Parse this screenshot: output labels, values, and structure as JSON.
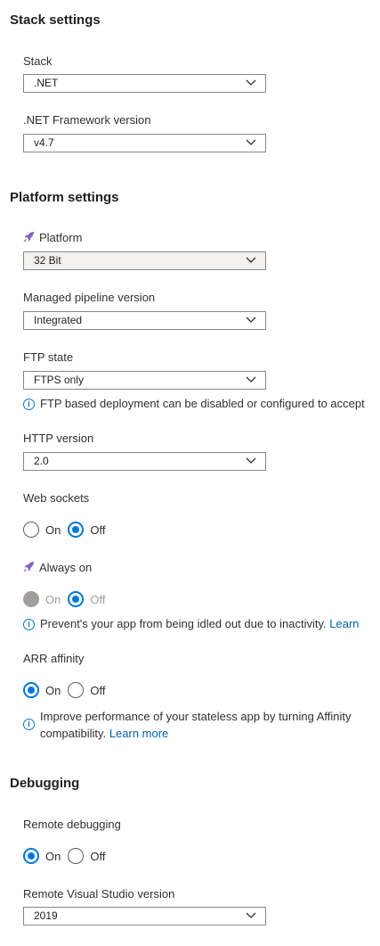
{
  "stack_settings": {
    "title": "Stack settings",
    "stack": {
      "label": "Stack",
      "value": ".NET"
    },
    "framework": {
      "label": ".NET Framework version",
      "value": "v4.7"
    }
  },
  "platform_settings": {
    "title": "Platform settings",
    "platform": {
      "label": "Platform",
      "value": "32 Bit"
    },
    "pipeline": {
      "label": "Managed pipeline version",
      "value": "Integrated"
    },
    "ftp": {
      "label": "FTP state",
      "value": "FTPS only",
      "info": "FTP based deployment can be disabled or configured to accept"
    },
    "http": {
      "label": "HTTP version",
      "value": "2.0"
    },
    "web_sockets": {
      "label": "Web sockets",
      "on": "On",
      "off": "Off",
      "selected": "Off"
    },
    "always_on": {
      "label": "Always on",
      "on": "On",
      "off": "Off",
      "selected": "Off",
      "info": "Prevent's your app from being idled out due to inactivity.",
      "info_link": "Learn"
    },
    "arr_affinity": {
      "label": "ARR affinity",
      "on": "On",
      "off": "Off",
      "selected": "On",
      "info_line1": "Improve performance of your stateless app by turning Affinity",
      "info_line2": "compatibility.",
      "info_link": "Learn more"
    }
  },
  "debugging": {
    "title": "Debugging",
    "remote_debugging": {
      "label": "Remote debugging",
      "on": "On",
      "off": "Off",
      "selected": "On"
    },
    "vs_version": {
      "label": "Remote Visual Studio version",
      "value": "2019"
    }
  },
  "colors": {
    "accent": "#0078d4",
    "link": "#0062ad",
    "rocket": "#8661c5"
  }
}
